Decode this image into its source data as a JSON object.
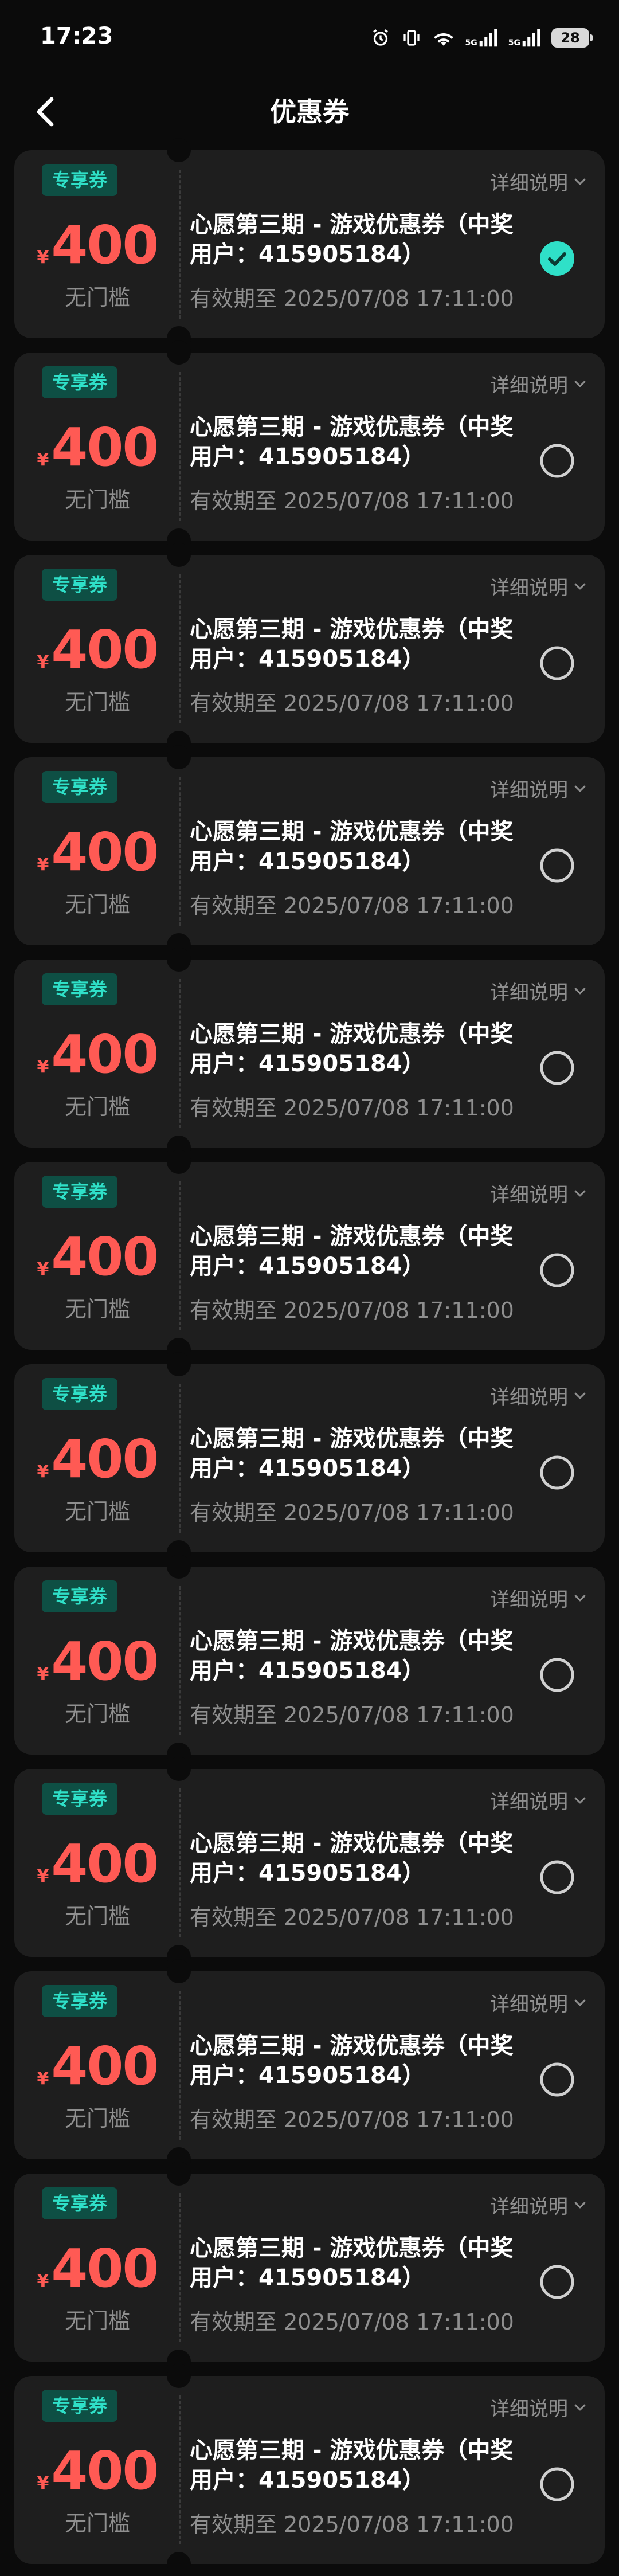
{
  "status_bar": {
    "time": "17:23",
    "network_1": "5G",
    "network_2": "5G",
    "battery": "28"
  },
  "header": {
    "title": "优惠券"
  },
  "colors": {
    "background": "#0b0b0b",
    "card": "#1e1e1e",
    "accent_teal": "#2fe0c8",
    "amount_red": "#ff5a54",
    "muted_text": "#8f8f8f"
  },
  "coupons": [
    {
      "tag": "专享券",
      "currency": "¥",
      "amount": "400",
      "threshold": "无门槛",
      "detail": "详细说明",
      "title": "心愿第三期 - 游戏优惠券（中奖用户：415905184）",
      "expiry": "有效期至 2025/07/08 17:11:00",
      "selected": true
    },
    {
      "tag": "专享券",
      "currency": "¥",
      "amount": "400",
      "threshold": "无门槛",
      "detail": "详细说明",
      "title": "心愿第三期 - 游戏优惠券（中奖用户：415905184）",
      "expiry": "有效期至 2025/07/08 17:11:00",
      "selected": false
    },
    {
      "tag": "专享券",
      "currency": "¥",
      "amount": "400",
      "threshold": "无门槛",
      "detail": "详细说明",
      "title": "心愿第三期 - 游戏优惠券（中奖用户：415905184）",
      "expiry": "有效期至 2025/07/08 17:11:00",
      "selected": false
    },
    {
      "tag": "专享券",
      "currency": "¥",
      "amount": "400",
      "threshold": "无门槛",
      "detail": "详细说明",
      "title": "心愿第三期 - 游戏优惠券（中奖用户：415905184）",
      "expiry": "有效期至 2025/07/08 17:11:00",
      "selected": false
    },
    {
      "tag": "专享券",
      "currency": "¥",
      "amount": "400",
      "threshold": "无门槛",
      "detail": "详细说明",
      "title": "心愿第三期 - 游戏优惠券（中奖用户：415905184）",
      "expiry": "有效期至 2025/07/08 17:11:00",
      "selected": false
    },
    {
      "tag": "专享券",
      "currency": "¥",
      "amount": "400",
      "threshold": "无门槛",
      "detail": "详细说明",
      "title": "心愿第三期 - 游戏优惠券（中奖用户：415905184）",
      "expiry": "有效期至 2025/07/08 17:11:00",
      "selected": false
    },
    {
      "tag": "专享券",
      "currency": "¥",
      "amount": "400",
      "threshold": "无门槛",
      "detail": "详细说明",
      "title": "心愿第三期 - 游戏优惠券（中奖用户：415905184）",
      "expiry": "有效期至 2025/07/08 17:11:00",
      "selected": false
    },
    {
      "tag": "专享券",
      "currency": "¥",
      "amount": "400",
      "threshold": "无门槛",
      "detail": "详细说明",
      "title": "心愿第三期 - 游戏优惠券（中奖用户：415905184）",
      "expiry": "有效期至 2025/07/08 17:11:00",
      "selected": false
    },
    {
      "tag": "专享券",
      "currency": "¥",
      "amount": "400",
      "threshold": "无门槛",
      "detail": "详细说明",
      "title": "心愿第三期 - 游戏优惠券（中奖用户：415905184）",
      "expiry": "有效期至 2025/07/08 17:11:00",
      "selected": false
    },
    {
      "tag": "专享券",
      "currency": "¥",
      "amount": "400",
      "threshold": "无门槛",
      "detail": "详细说明",
      "title": "心愿第三期 - 游戏优惠券（中奖用户：415905184）",
      "expiry": "有效期至 2025/07/08 17:11:00",
      "selected": false
    },
    {
      "tag": "专享券",
      "currency": "¥",
      "amount": "400",
      "threshold": "无门槛",
      "detail": "详细说明",
      "title": "心愿第三期 - 游戏优惠券（中奖用户：415905184）",
      "expiry": "有效期至 2025/07/08 17:11:00",
      "selected": false
    },
    {
      "tag": "专享券",
      "currency": "¥",
      "amount": "400",
      "threshold": "无门槛",
      "detail": "详细说明",
      "title": "心愿第三期 - 游戏优惠券（中奖用户：415905184）",
      "expiry": "有效期至 2025/07/08 17:11:00",
      "selected": false
    }
  ]
}
